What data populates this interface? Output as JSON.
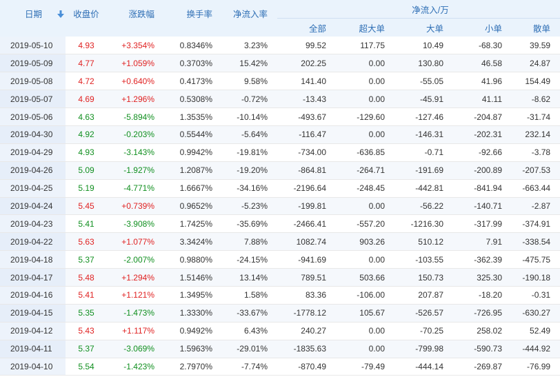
{
  "headers": {
    "date": "日期",
    "close": "收盘价",
    "change": "涨跌幅",
    "turnover": "换手率",
    "netflow_rate": "净流入率",
    "netflow_group": "净流入/万",
    "total": "全部",
    "super_large": "超大单",
    "large": "大单",
    "small": "小单",
    "retail": "散单"
  },
  "sort_icon": "sort-down-arrow-icon",
  "colors": {
    "up": "#e02222",
    "down": "#108f1f",
    "header_bg": "#eaf3fc",
    "header_text": "#2f6fb5"
  },
  "rows": [
    {
      "date": "2019-05-10",
      "close": "4.93",
      "change": "+3.354%",
      "turnover": "0.8346%",
      "netflow_rate": "3.23%",
      "total": "99.52",
      "super_large": "117.75",
      "large": "10.49",
      "small": "-68.30",
      "retail": "39.59",
      "trend": "up"
    },
    {
      "date": "2019-05-09",
      "close": "4.77",
      "change": "+1.059%",
      "turnover": "0.3703%",
      "netflow_rate": "15.42%",
      "total": "202.25",
      "super_large": "0.00",
      "large": "130.80",
      "small": "46.58",
      "retail": "24.87",
      "trend": "up"
    },
    {
      "date": "2019-05-08",
      "close": "4.72",
      "change": "+0.640%",
      "turnover": "0.4173%",
      "netflow_rate": "9.58%",
      "total": "141.40",
      "super_large": "0.00",
      "large": "-55.05",
      "small": "41.96",
      "retail": "154.49",
      "trend": "up"
    },
    {
      "date": "2019-05-07",
      "close": "4.69",
      "change": "+1.296%",
      "turnover": "0.5308%",
      "netflow_rate": "-0.72%",
      "total": "-13.43",
      "super_large": "0.00",
      "large": "-45.91",
      "small": "41.11",
      "retail": "-8.62",
      "trend": "up"
    },
    {
      "date": "2019-05-06",
      "close": "4.63",
      "change": "-5.894%",
      "turnover": "1.3535%",
      "netflow_rate": "-10.14%",
      "total": "-493.67",
      "super_large": "-129.60",
      "large": "-127.46",
      "small": "-204.87",
      "retail": "-31.74",
      "trend": "down"
    },
    {
      "date": "2019-04-30",
      "close": "4.92",
      "change": "-0.203%",
      "turnover": "0.5544%",
      "netflow_rate": "-5.64%",
      "total": "-116.47",
      "super_large": "0.00",
      "large": "-146.31",
      "small": "-202.31",
      "retail": "232.14",
      "trend": "down"
    },
    {
      "date": "2019-04-29",
      "close": "4.93",
      "change": "-3.143%",
      "turnover": "0.9942%",
      "netflow_rate": "-19.81%",
      "total": "-734.00",
      "super_large": "-636.85",
      "large": "-0.71",
      "small": "-92.66",
      "retail": "-3.78",
      "trend": "down"
    },
    {
      "date": "2019-04-26",
      "close": "5.09",
      "change": "-1.927%",
      "turnover": "1.2087%",
      "netflow_rate": "-19.20%",
      "total": "-864.81",
      "super_large": "-264.71",
      "large": "-191.69",
      "small": "-200.89",
      "retail": "-207.53",
      "trend": "down"
    },
    {
      "date": "2019-04-25",
      "close": "5.19",
      "change": "-4.771%",
      "turnover": "1.6667%",
      "netflow_rate": "-34.16%",
      "total": "-2196.64",
      "super_large": "-248.45",
      "large": "-442.81",
      "small": "-841.94",
      "retail": "-663.44",
      "trend": "down"
    },
    {
      "date": "2019-04-24",
      "close": "5.45",
      "change": "+0.739%",
      "turnover": "0.9652%",
      "netflow_rate": "-5.23%",
      "total": "-199.81",
      "super_large": "0.00",
      "large": "-56.22",
      "small": "-140.71",
      "retail": "-2.87",
      "trend": "up"
    },
    {
      "date": "2019-04-23",
      "close": "5.41",
      "change": "-3.908%",
      "turnover": "1.7425%",
      "netflow_rate": "-35.69%",
      "total": "-2466.41",
      "super_large": "-557.20",
      "large": "-1216.30",
      "small": "-317.99",
      "retail": "-374.91",
      "trend": "down"
    },
    {
      "date": "2019-04-22",
      "close": "5.63",
      "change": "+1.077%",
      "turnover": "3.3424%",
      "netflow_rate": "7.88%",
      "total": "1082.74",
      "super_large": "903.26",
      "large": "510.12",
      "small": "7.91",
      "retail": "-338.54",
      "trend": "up"
    },
    {
      "date": "2019-04-18",
      "close": "5.37",
      "change": "-2.007%",
      "turnover": "0.9880%",
      "netflow_rate": "-24.15%",
      "total": "-941.69",
      "super_large": "0.00",
      "large": "-103.55",
      "small": "-362.39",
      "retail": "-475.75",
      "trend": "down"
    },
    {
      "date": "2019-04-17",
      "close": "5.48",
      "change": "+1.294%",
      "turnover": "1.5146%",
      "netflow_rate": "13.14%",
      "total": "789.51",
      "super_large": "503.66",
      "large": "150.73",
      "small": "325.30",
      "retail": "-190.18",
      "trend": "up"
    },
    {
      "date": "2019-04-16",
      "close": "5.41",
      "change": "+1.121%",
      "turnover": "1.3495%",
      "netflow_rate": "1.58%",
      "total": "83.36",
      "super_large": "-106.00",
      "large": "207.87",
      "small": "-18.20",
      "retail": "-0.31",
      "trend": "up"
    },
    {
      "date": "2019-04-15",
      "close": "5.35",
      "change": "-1.473%",
      "turnover": "1.3330%",
      "netflow_rate": "-33.67%",
      "total": "-1778.12",
      "super_large": "105.67",
      "large": "-526.57",
      "small": "-726.95",
      "retail": "-630.27",
      "trend": "down"
    },
    {
      "date": "2019-04-12",
      "close": "5.43",
      "change": "+1.117%",
      "turnover": "0.9492%",
      "netflow_rate": "6.43%",
      "total": "240.27",
      "super_large": "0.00",
      "large": "-70.25",
      "small": "258.02",
      "retail": "52.49",
      "trend": "up"
    },
    {
      "date": "2019-04-11",
      "close": "5.37",
      "change": "-3.069%",
      "turnover": "1.5963%",
      "netflow_rate": "-29.01%",
      "total": "-1835.63",
      "super_large": "0.00",
      "large": "-799.98",
      "small": "-590.73",
      "retail": "-444.92",
      "trend": "down"
    },
    {
      "date": "2019-04-10",
      "close": "5.54",
      "change": "-1.423%",
      "turnover": "2.7970%",
      "netflow_rate": "-7.74%",
      "total": "-870.49",
      "super_large": "-79.49",
      "large": "-444.14",
      "small": "-269.87",
      "retail": "-76.99",
      "trend": "down"
    }
  ]
}
